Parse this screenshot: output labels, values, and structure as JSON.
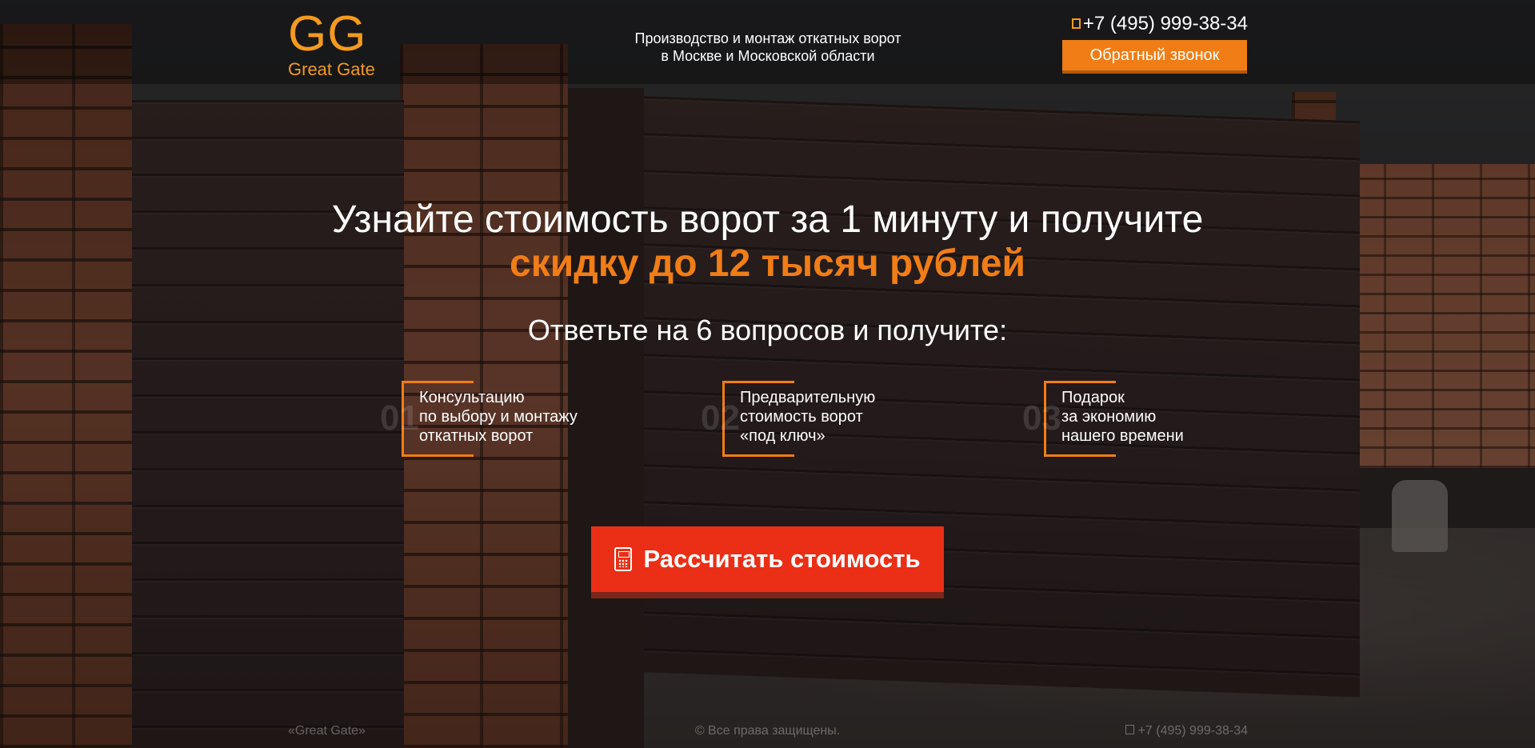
{
  "brand": {
    "logo_mark": "GG",
    "logo_text": "Great Gate",
    "color": "#f39a1f"
  },
  "header": {
    "tagline_line1": "Производство и монтаж откатных ворот",
    "tagline_line2": "в Москве и Московской области",
    "phone": "+7 (495) 999-38-34",
    "phone_icon": "phone-icon",
    "callback_label": "Обратный звонок"
  },
  "hero": {
    "title": "Узнайте стоимость ворот за 1 минуту и получите",
    "highlight": "скидку до 12 тысяч рублей",
    "subtitle": "Ответьте на 6 вопросов и получите:"
  },
  "benefits": [
    {
      "number": "01",
      "lines": [
        "Консультацию",
        "по выбору и монтажу",
        "откатных ворот"
      ]
    },
    {
      "number": "02",
      "lines": [
        "Предварительную",
        "стоимость ворот",
        "«под ключ»"
      ]
    },
    {
      "number": "03",
      "lines": [
        "Подарок",
        "за экономию",
        "нашего времени"
      ]
    }
  ],
  "cta": {
    "label": "Рассчитать стоимость",
    "icon": "calculator-icon"
  },
  "footer": {
    "brand": "«Great Gate»",
    "copyright": "© Все права защищены.",
    "phone": "+7 (495) 999-38-34"
  },
  "colors": {
    "accent_orange": "#f07d16",
    "cta_red": "#ea2f16"
  }
}
